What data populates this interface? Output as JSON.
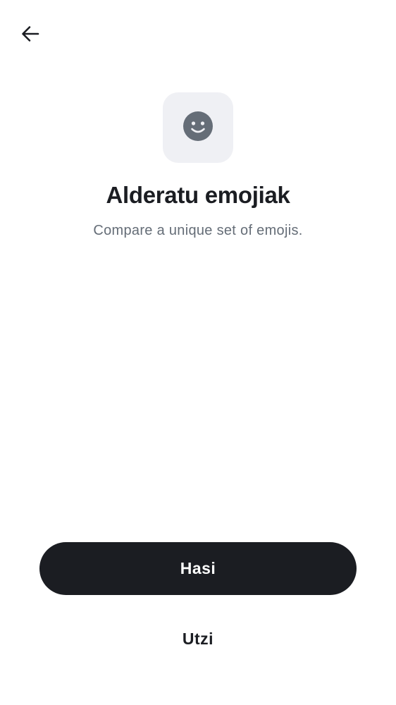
{
  "header": {
    "back_icon": "arrow-left-icon"
  },
  "hero": {
    "icon": "smiley-face-icon",
    "title": "Alderatu emojiak",
    "subtitle": "Compare a unique set of emojis."
  },
  "actions": {
    "primary_label": "Hasi",
    "secondary_label": "Utzi"
  },
  "colors": {
    "primary": "#1b1d22",
    "icon_tile_bg": "#eff0f4",
    "icon_fg": "#656d77",
    "subtitle": "#656d77",
    "background": "#ffffff"
  }
}
